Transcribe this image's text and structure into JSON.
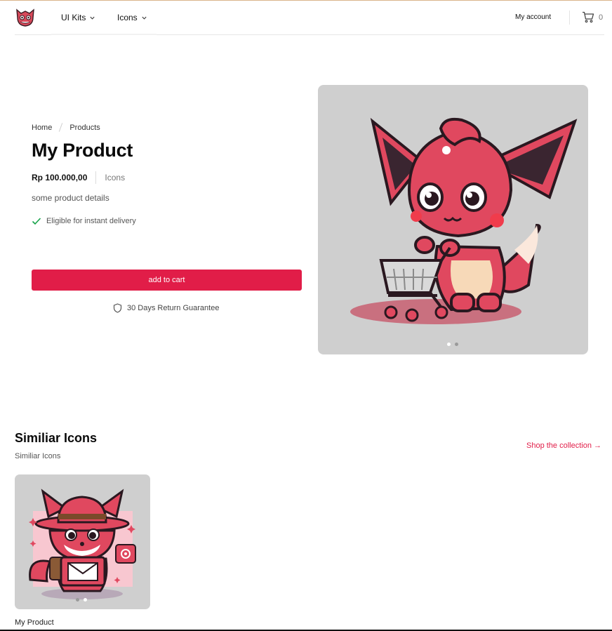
{
  "header": {
    "logo_icon": "fox-mascot-logo",
    "nav": [
      {
        "label": "UI Kits",
        "icon": "chevron-down-icon"
      },
      {
        "label": "Icons",
        "icon": "chevron-down-icon"
      }
    ],
    "account_label": "My account",
    "cart_icon": "cart-icon",
    "cart_count": "0"
  },
  "product": {
    "breadcrumb": [
      "Home",
      "Products"
    ],
    "title": "My Product",
    "price": "Rp 100.000,00",
    "category": "Icons",
    "details": "some product details",
    "delivery": "Eligible for instant delivery",
    "add_to_cart_label": "add to cart",
    "guarantee": "30 Days Return Guarantee",
    "image_icon": "fox-with-shopping-cart-illustration",
    "image_count": 2,
    "active_image": 1
  },
  "similar": {
    "title": "Similiar Icons",
    "subtitle": "Similiar Icons",
    "link_label": "Shop the collection →",
    "items": [
      {
        "name": "My Product",
        "image_icon": "fox-with-mail-illustration",
        "image_count": 2,
        "active_image": 2
      }
    ]
  },
  "colors": {
    "accent": "#e11d48",
    "image_bg": "#cfcfcf",
    "delivery_check": "#16a34a"
  }
}
